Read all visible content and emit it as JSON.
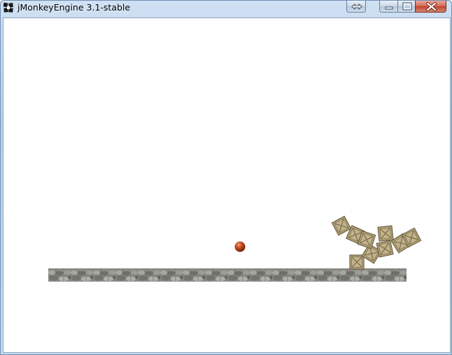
{
  "window": {
    "title": "jMonkeyEngine 3.1-stable",
    "icons": {
      "app": "jmonkey-app-icon",
      "swap": "swap-arrows-icon",
      "minimize": "minimize-icon",
      "maximize": "maximize-icon",
      "close": "close-icon"
    },
    "colors": {
      "close_button": "#c7432c",
      "titlebar": "#b9d1ea"
    }
  },
  "scene": {
    "background": "#ffffff",
    "objects": [
      "stone-floor",
      "cannonball",
      "crate-pile"
    ],
    "colors": {
      "floor": "#8a8a86",
      "ball": "#c4481e",
      "crate": "#b5a57c"
    },
    "crate_count": 9
  }
}
